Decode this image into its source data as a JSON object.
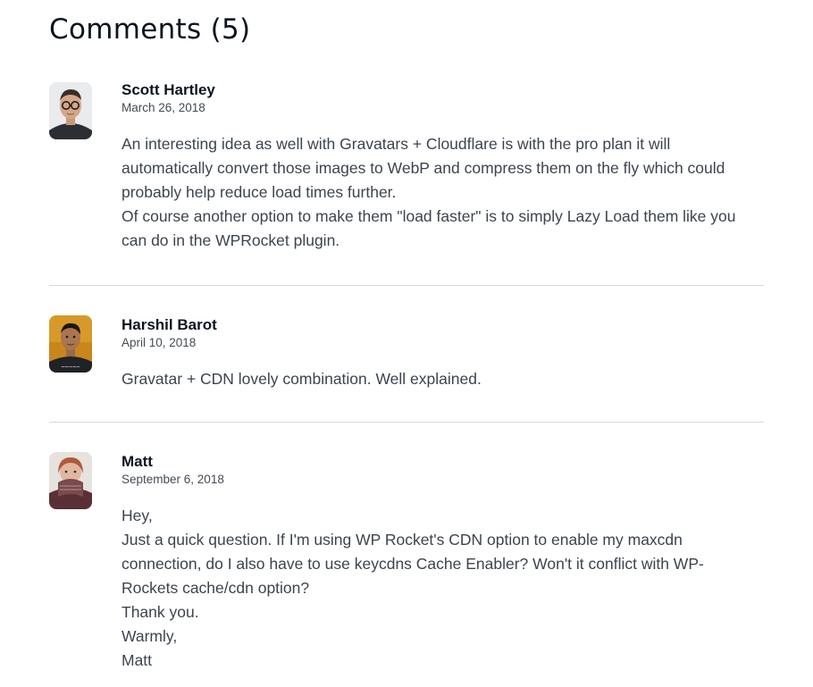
{
  "comments_section": {
    "heading": "Comments (5)",
    "comments": [
      {
        "author": "Scott Hartley",
        "date": "March 26, 2018",
        "lines": [
          "An interesting idea as well with Gravatars + Cloudflare is with the pro plan it will",
          "automatically convert those images to WebP and compress them on the fly which could",
          "probably help reduce load times further.",
          "Of course another option to make them \"load faster\" is to simply Lazy Load them like you",
          "can do in the WPRocket plugin."
        ]
      },
      {
        "author": "Harshil Barot",
        "date": "April 10, 2018",
        "lines": [
          "Gravatar + CDN lovely combination. Well explained."
        ]
      },
      {
        "author": "Matt",
        "date": "September 6, 2018",
        "lines": [
          "Hey,",
          "Just a quick question. If I'm using WP Rocket's CDN option to enable my maxcdn",
          "connection, do I also have to use keycdns Cache Enabler? Won't it conflict with WP-",
          "Rockets cache/cdn option?",
          "Thank you.",
          "Warmly,",
          "Matt"
        ]
      }
    ]
  }
}
